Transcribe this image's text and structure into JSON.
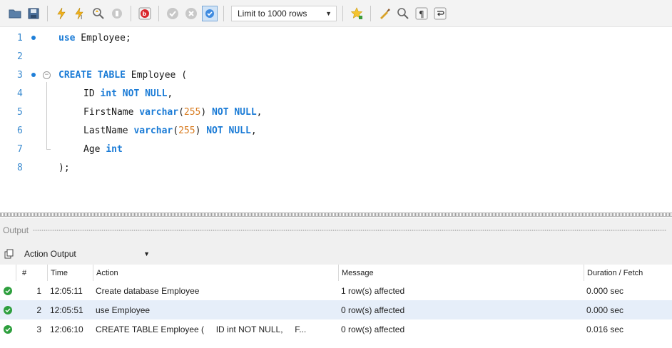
{
  "colors": {
    "keyword": "#1a7bd6",
    "number": "#d87b1f",
    "line_number": "#3b8bd0",
    "breakpoint_dot": "#1f7fd8",
    "success_green": "#2e9f3e",
    "alt_row": "#e6eef9"
  },
  "toolbar": {
    "icons": [
      "open-folder-icon",
      "save-icon",
      "execute-icon",
      "execute-current-icon",
      "explain-icon",
      "stop-icon",
      "toggle-error-icon",
      "commit-icon",
      "rollback-icon",
      "autocommit-icon",
      "beautify-favorite-icon",
      "beautify-icon",
      "find-icon",
      "invisible-chars-icon",
      "wrap-icon"
    ],
    "limit_label": "Limit to 1000 rows"
  },
  "editor": {
    "lines": [
      {
        "n": "1"
      },
      {
        "n": "2"
      },
      {
        "n": "3"
      },
      {
        "n": "4"
      },
      {
        "n": "5"
      },
      {
        "n": "6"
      },
      {
        "n": "7"
      },
      {
        "n": "8"
      }
    ],
    "tokens": {
      "l1_kw": "use",
      "l1_rest": " Employee;",
      "l3_kw": "CREATE TABLE",
      "l3_rest": " Employee (",
      "l4_a": "ID ",
      "l4_kw": "int NOT NULL",
      "l4_b": ",",
      "l5_a": "FirstName ",
      "l5_kw1": "varchar",
      "l5_b": "(",
      "l5_num": "255",
      "l5_c": ") ",
      "l5_kw2": "NOT NULL",
      "l5_d": ",",
      "l6_a": "LastName ",
      "l6_kw1": "varchar",
      "l6_b": "(",
      "l6_num": "255",
      "l6_c": ") ",
      "l6_kw2": "NOT NULL",
      "l6_d": ",",
      "l7_a": "Age ",
      "l7_kw": "int",
      "l8": ");"
    }
  },
  "output": {
    "title": "Output",
    "selector": "Action Output",
    "columns": {
      "num": "#",
      "time": "Time",
      "action": "Action",
      "message": "Message",
      "duration": "Duration / Fetch"
    },
    "rows": [
      {
        "num": "1",
        "time": "12:05:11",
        "action": "Create database Employee",
        "message": "1 row(s) affected",
        "duration": "0.000 sec"
      },
      {
        "num": "2",
        "time": "12:05:51",
        "action": "use Employee",
        "message": "0 row(s) affected",
        "duration": "0.000 sec"
      },
      {
        "num": "3",
        "time": "12:06:10",
        "action": "CREATE TABLE Employee (     ID int NOT NULL,     F...",
        "message": "0 row(s) affected",
        "duration": "0.016 sec"
      }
    ]
  }
}
